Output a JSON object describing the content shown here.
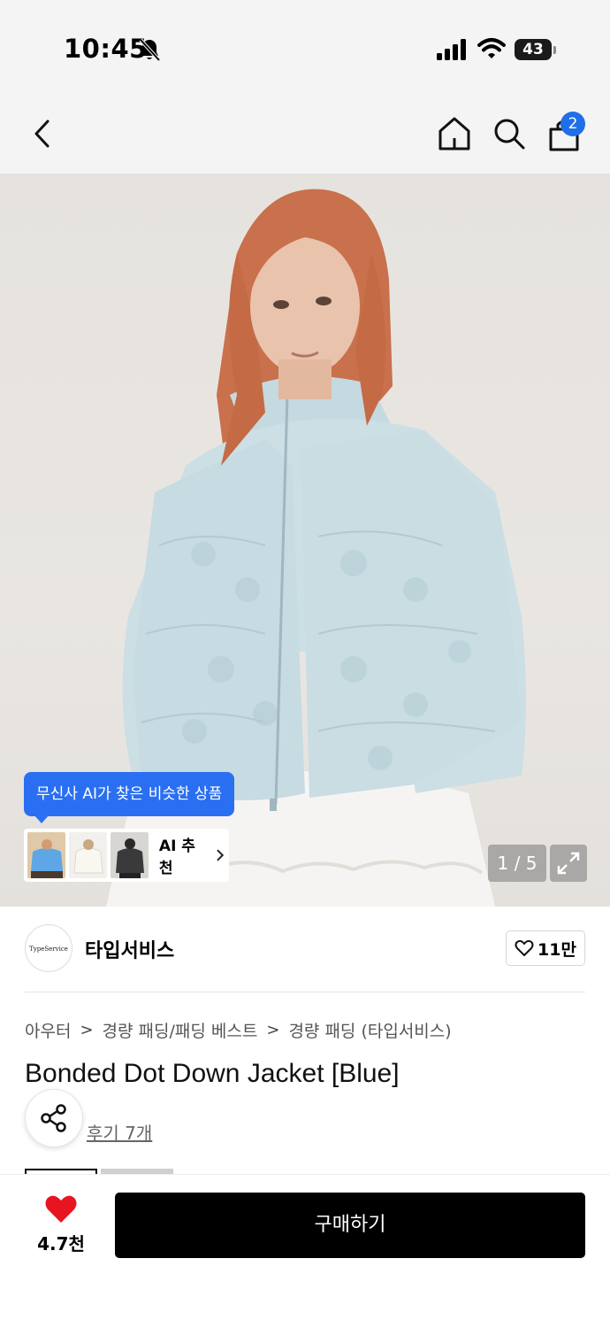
{
  "status_bar": {
    "time": "10:45",
    "battery": "43",
    "icons": [
      "bell-slash-icon",
      "signal-icon",
      "wifi-icon",
      "battery-icon"
    ]
  },
  "header": {
    "icons": [
      "back-icon",
      "home-icon",
      "search-icon",
      "shopping-bag-icon"
    ],
    "cart_badge": "2"
  },
  "gallery": {
    "ai_tooltip": "무신사 AI가 찾은 비슷한 상품",
    "ai_label": "AI 추천",
    "page_counter": "1 / 5",
    "current_page": 1,
    "total_pages": 5
  },
  "brand": {
    "logo_text": "TypeService",
    "name": "타입서비스",
    "likes": "11만"
  },
  "breadcrumb": {
    "items": [
      "아우터",
      "경량 패딩/패딩 베스트",
      "경량 패딩 (타입서비스)"
    ],
    "separator": ">"
  },
  "product": {
    "title": "Bonded Dot Down Jacket [Blue]",
    "reviews": "후기 7개"
  },
  "bottom": {
    "wish_count": "4.7천",
    "buy_label": "구매하기"
  },
  "colors": {
    "accent_blue": "#2a6ff2",
    "badge_blue": "#1f6fe8",
    "heart_red": "#e8141f",
    "buy_black": "#000000"
  }
}
